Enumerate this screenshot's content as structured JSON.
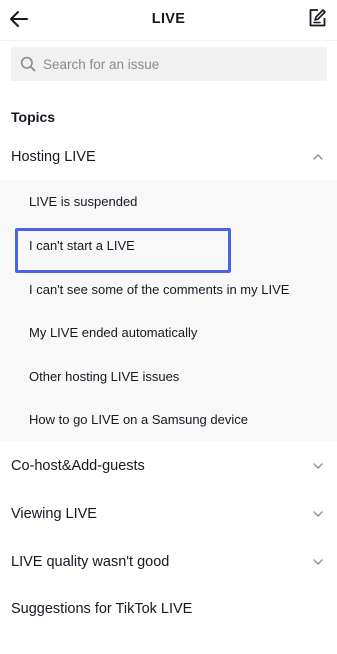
{
  "header": {
    "title": "LIVE",
    "back_icon": "arrow-left-icon",
    "edit_icon": "edit-feedback-icon"
  },
  "search": {
    "placeholder": "Search for an issue",
    "value": "",
    "icon": "search-icon"
  },
  "topics_label": "Topics",
  "sections": [
    {
      "label": "Hosting LIVE",
      "expanded": true,
      "items": [
        "LIVE is suspended",
        "I can't start a LIVE",
        "I can't see some of the comments in my LIVE",
        "My LIVE ended automatically",
        "Other hosting LIVE issues",
        "How to go LIVE on a Samsung device"
      ]
    },
    {
      "label": "Co-host&Add-guests",
      "expanded": false
    },
    {
      "label": "Viewing LIVE",
      "expanded": false
    },
    {
      "label": "LIVE quality wasn't good",
      "expanded": false
    },
    {
      "label": "Suggestions for TikTok LIVE",
      "expanded": false
    }
  ],
  "highlighted_item": "I can't start a LIVE",
  "colors": {
    "highlight": "#4a64e8",
    "text": "#161823",
    "muted": "#8a8b91",
    "search_bg": "#f1f1f2",
    "sub_list_bg": "#f8f8f8"
  }
}
